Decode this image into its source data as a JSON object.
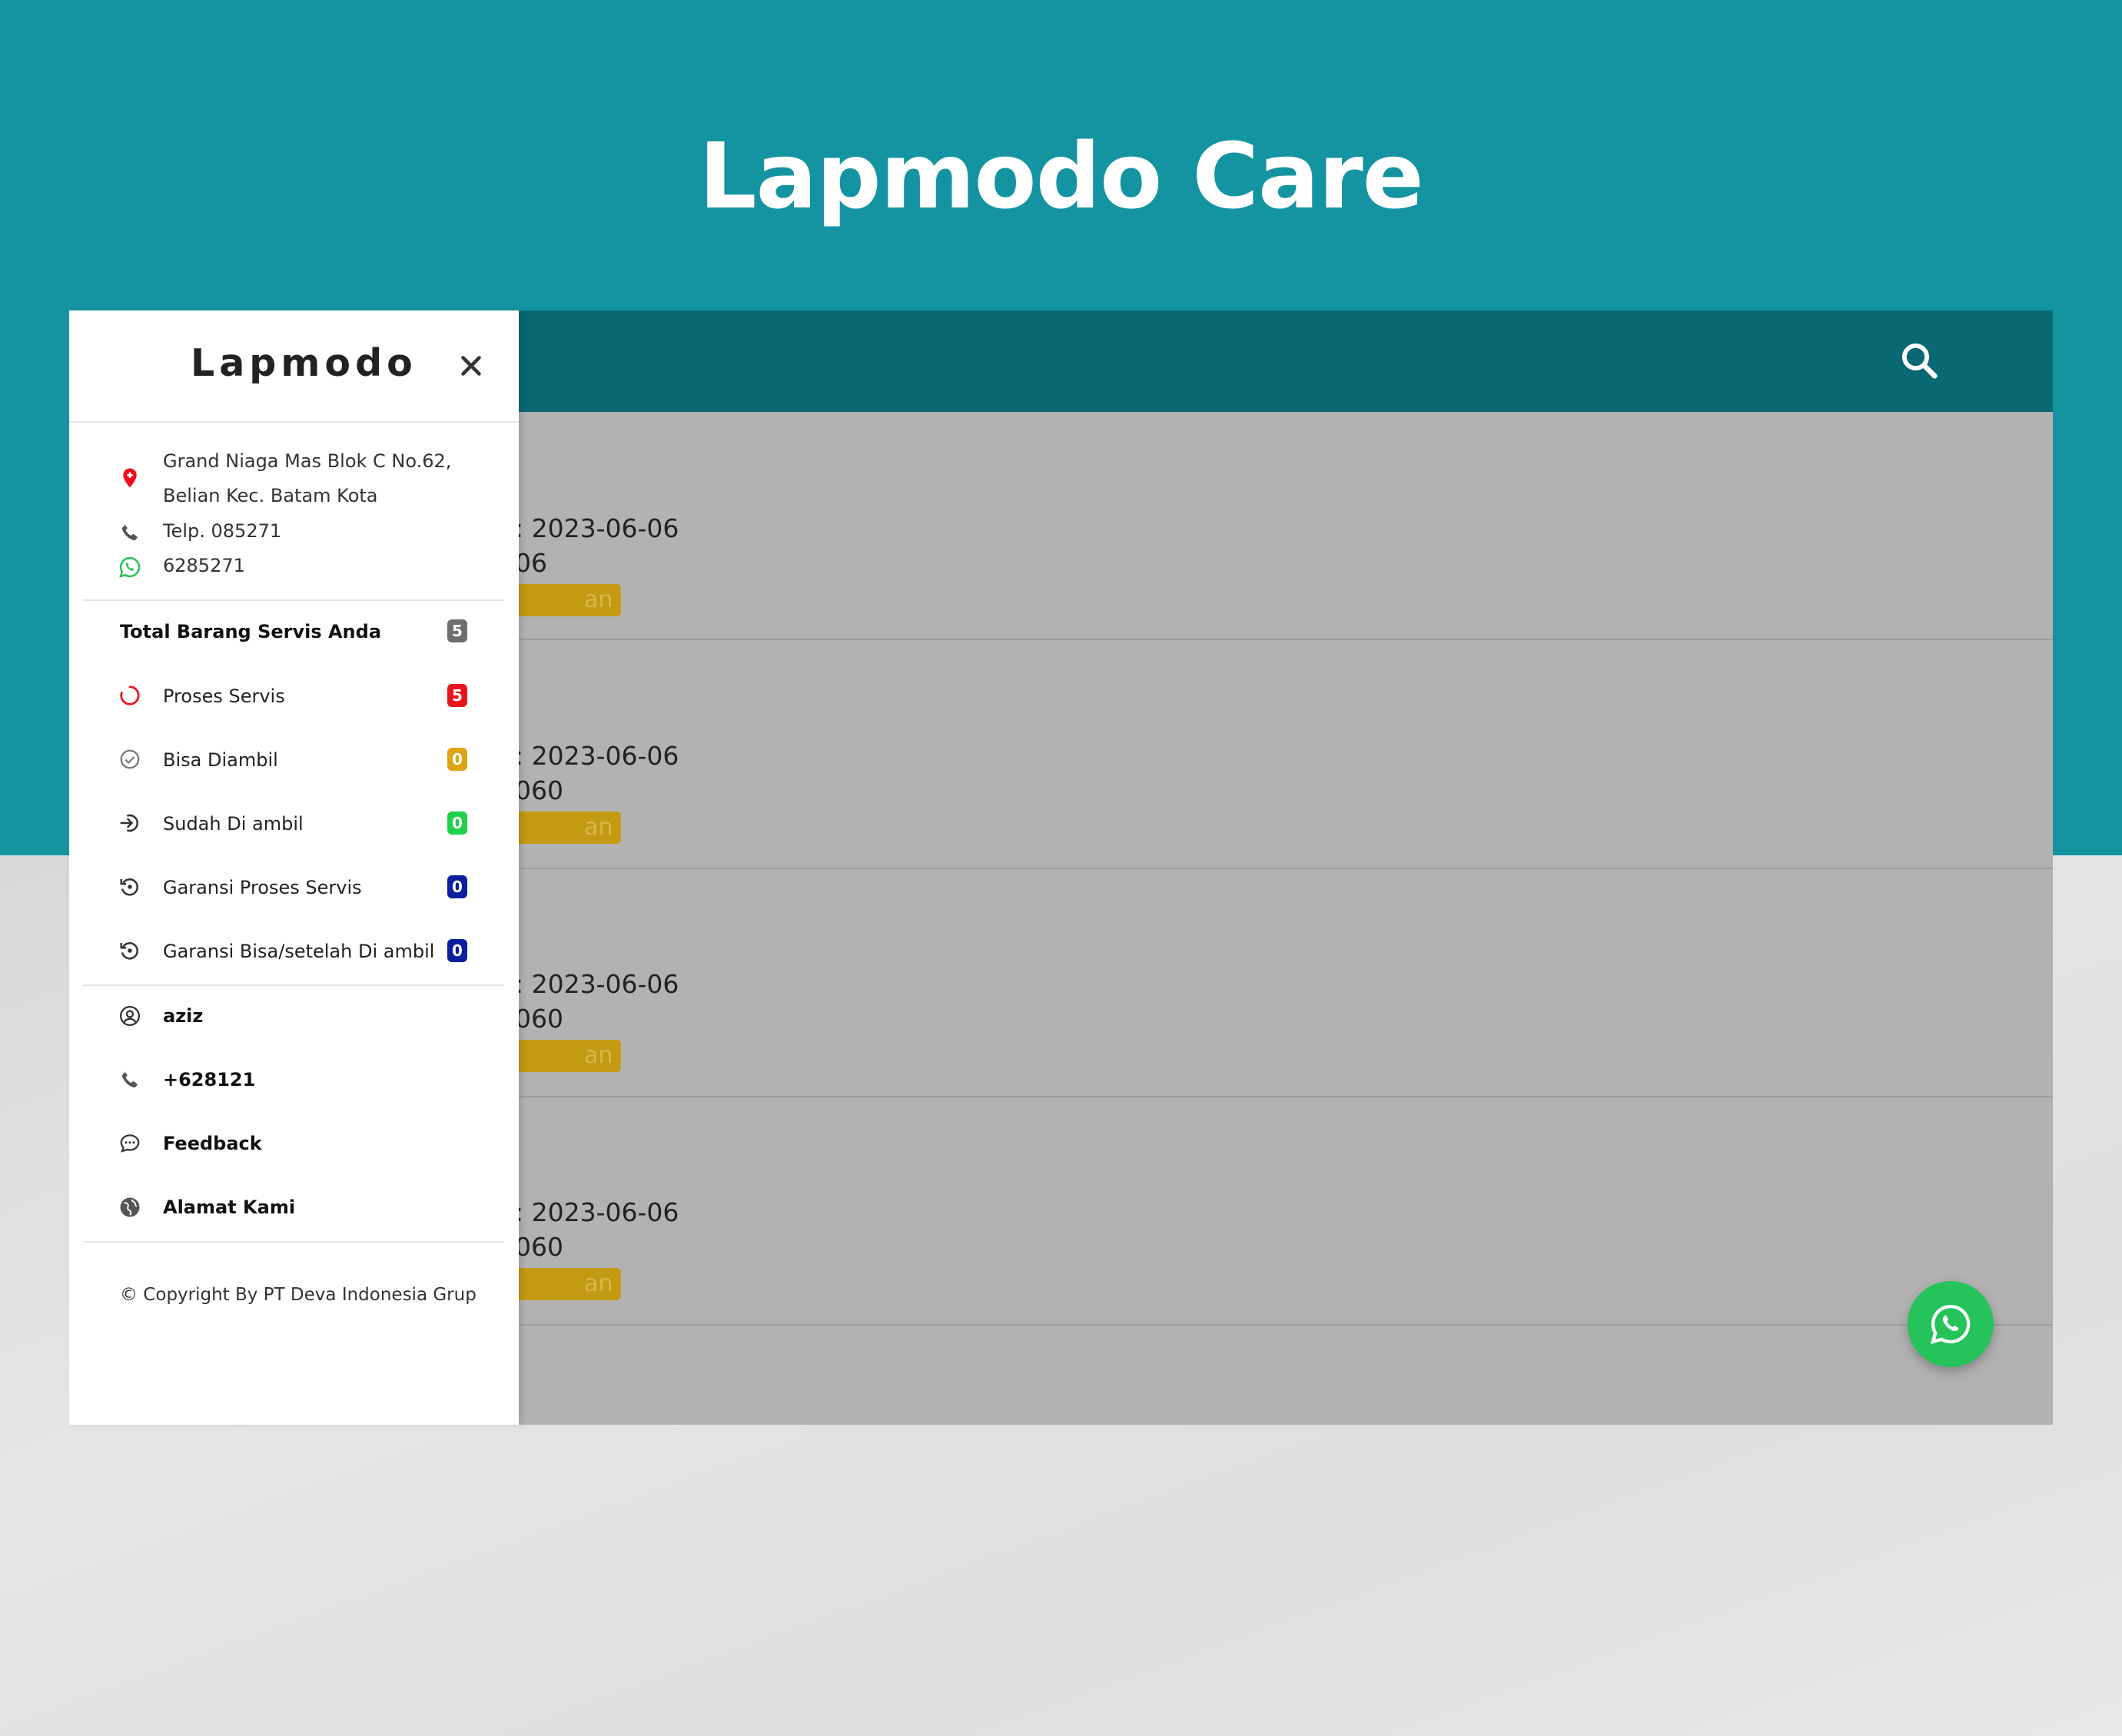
{
  "page": {
    "title": "Lapmodo Care"
  },
  "drawer": {
    "brand": "Lapmodo",
    "address_line1": "Grand Niaga Mas Blok C No.62,",
    "address_line2": "Belian Kec. Batam Kota",
    "phone": "Telp. 085271",
    "whatsapp": "6285271",
    "total_label": "Total Barang Servis Anda",
    "total_count": "5",
    "status_items": [
      {
        "label": "Proses Servis",
        "count": "5",
        "color": "#e8141c",
        "icon": "spinner-icon"
      },
      {
        "label": "Bisa Diambil",
        "count": "0",
        "color": "#e0a312",
        "icon": "check-circle-icon"
      },
      {
        "label": "Sudah Di ambil",
        "count": "0",
        "color": "#1fd14a",
        "icon": "sign-in-icon"
      },
      {
        "label": "Garansi Proses Servis",
        "count": "0",
        "color": "#0a1f9e",
        "icon": "warranty-icon"
      },
      {
        "label": "Garansi Bisa/setelah Di ambil",
        "count": "0",
        "color": "#0a1f9e",
        "icon": "warranty-icon"
      }
    ],
    "user_items": [
      {
        "label": "aziz",
        "icon": "user-circle-icon"
      },
      {
        "label": "+628121",
        "icon": "phone-icon"
      },
      {
        "label": "Feedback",
        "icon": "chat-icon"
      },
      {
        "label": "Alamat Kami",
        "icon": "globe-icon"
      }
    ],
    "copyright": "© Copyright By PT Deva Indonesia Grup"
  },
  "list": {
    "rows": [
      {
        "date": ": 2023-06-06",
        "code": "06",
        "badge": "an"
      },
      {
        "date": ": 2023-06-06",
        "code": "060",
        "badge": "an"
      },
      {
        "date": ": 2023-06-06",
        "code": "060",
        "badge": "an"
      },
      {
        "date": ": 2023-06-06",
        "code": "060",
        "badge": "an"
      }
    ]
  },
  "colors": {
    "header_bg": "#1494a1",
    "appbar_bg": "#0a6872",
    "badge_bg": "#c49a12",
    "whatsapp_green": "#25c35a",
    "total_badge": "#6f6f6f"
  }
}
